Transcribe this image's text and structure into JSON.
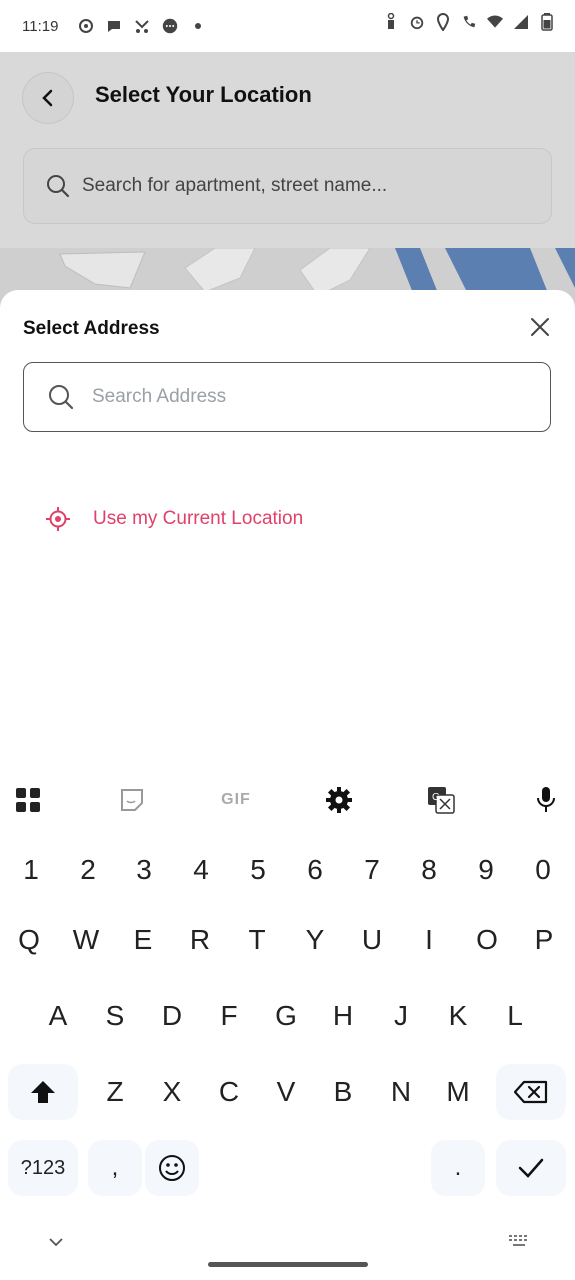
{
  "status_bar": {
    "time": "11:19"
  },
  "app": {
    "page_title": "Select Your Location",
    "search_placeholder": "Search for apartment, street name..."
  },
  "sheet": {
    "title": "Select Address",
    "search_placeholder": "Search Address",
    "current_location_label": "Use my Current Location",
    "accent_color": "#e0406a"
  },
  "keyboard": {
    "toolbar": [
      "apps-icon",
      "sticker-icon",
      "GIF",
      "gear-icon",
      "translate-icon",
      "mic-icon"
    ],
    "gif_label": "GIF",
    "numbers": [
      "1",
      "2",
      "3",
      "4",
      "5",
      "6",
      "7",
      "8",
      "9",
      "0"
    ],
    "row1": [
      "Q",
      "W",
      "E",
      "R",
      "T",
      "Y",
      "U",
      "I",
      "O",
      "P"
    ],
    "row2": [
      "A",
      "S",
      "D",
      "F",
      "G",
      "H",
      "J",
      "K",
      "L"
    ],
    "row3": [
      "Z",
      "X",
      "C",
      "V",
      "B",
      "N",
      "M"
    ],
    "symbols_key": "?123",
    "comma_key": ",",
    "period_key": "."
  }
}
